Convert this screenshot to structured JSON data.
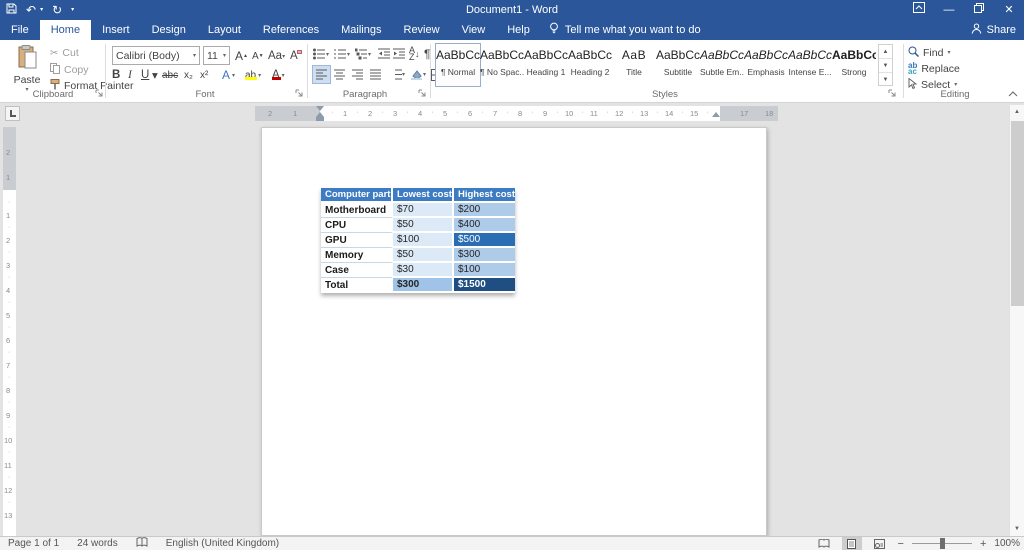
{
  "title_bar": {
    "title": "Document1 - Word"
  },
  "tabs": {
    "items": [
      {
        "label": "File",
        "active": false
      },
      {
        "label": "Home",
        "active": true
      },
      {
        "label": "Insert",
        "active": false
      },
      {
        "label": "Design",
        "active": false
      },
      {
        "label": "Layout",
        "active": false
      },
      {
        "label": "References",
        "active": false
      },
      {
        "label": "Mailings",
        "active": false
      },
      {
        "label": "Review",
        "active": false
      },
      {
        "label": "View",
        "active": false
      },
      {
        "label": "Help",
        "active": false
      }
    ],
    "tell_me": "Tell me what you want to do",
    "share": "Share"
  },
  "ribbon": {
    "clipboard": {
      "label": "Clipboard",
      "paste": "Paste",
      "cut": "Cut",
      "copy": "Copy",
      "format_painter": "Format Painter"
    },
    "font": {
      "label": "Font",
      "name": "Calibri (Body)",
      "size": "11",
      "bold": "B",
      "italic": "I",
      "underline": "U",
      "strike": "abc",
      "sub": "x₂",
      "sup": "x²",
      "grow": "A",
      "shrink": "A",
      "change_case": "Aa"
    },
    "paragraph": {
      "label": "Paragraph",
      "pilcrow": "¶"
    },
    "styles": {
      "label": "Styles",
      "items": [
        {
          "preview": "AaBbCcDc",
          "name": "¶ Normal",
          "cls": "",
          "selected": true
        },
        {
          "preview": "AaBbCcDc",
          "name": "¶ No Spac...",
          "cls": "",
          "selected": false
        },
        {
          "preview": "AaBbCc",
          "name": "Heading 1",
          "cls": "pv-h1",
          "selected": false
        },
        {
          "preview": "AaBbCcC",
          "name": "Heading 2",
          "cls": "pv-h2",
          "selected": false
        },
        {
          "preview": "AaB",
          "name": "Title",
          "cls": "pv-title",
          "selected": false
        },
        {
          "preview": "AaBbCcD",
          "name": "Subtitle",
          "cls": "pv-subtitle",
          "selected": false
        },
        {
          "preview": "AaBbCcDc",
          "name": "Subtle Em...",
          "cls": "pv-subtle",
          "selected": false
        },
        {
          "preview": "AaBbCcDc",
          "name": "Emphasis",
          "cls": "pv-emph",
          "selected": false
        },
        {
          "preview": "AaBbCcDc",
          "name": "Intense E...",
          "cls": "pv-intense",
          "selected": false
        },
        {
          "preview": "AaBbCcDc",
          "name": "Strong",
          "cls": "pv-strong",
          "selected": false
        }
      ]
    },
    "editing": {
      "label": "Editing",
      "find": "Find",
      "replace": "Replace",
      "select": "Select"
    }
  },
  "document": {
    "table": {
      "headers": [
        "Computer part",
        "Lowest cost",
        "Highest cost"
      ],
      "rows": [
        {
          "cells": [
            {
              "t": "Motherboard",
              "c": "part"
            },
            {
              "t": "$70",
              "c": "low"
            },
            {
              "t": "$200",
              "c": "high"
            }
          ]
        },
        {
          "cells": [
            {
              "t": "CPU",
              "c": "part"
            },
            {
              "t": "$50",
              "c": "low"
            },
            {
              "t": "$400",
              "c": "high"
            }
          ]
        },
        {
          "cells": [
            {
              "t": "GPU",
              "c": "part"
            },
            {
              "t": "$100",
              "c": "low"
            },
            {
              "t": "$500",
              "c": "high dark"
            }
          ]
        },
        {
          "cells": [
            {
              "t": "Memory",
              "c": "part"
            },
            {
              "t": "$50",
              "c": "low"
            },
            {
              "t": "$300",
              "c": "high"
            }
          ]
        },
        {
          "cells": [
            {
              "t": "Case",
              "c": "part"
            },
            {
              "t": "$30",
              "c": "low"
            },
            {
              "t": "$100",
              "c": "high"
            }
          ]
        },
        {
          "cells": [
            {
              "t": "Total",
              "c": "part totalpart"
            },
            {
              "t": "$300",
              "c": "low totallow"
            },
            {
              "t": "$1500",
              "c": "high totalhigh"
            }
          ]
        }
      ],
      "colors": {
        "header": "#3d7cc2",
        "low": "#dce9f6",
        "high": "#aecbe9",
        "dark": "#2a6db3",
        "total_dark": "#1f4f82",
        "total_low": "#9fc4e7"
      }
    }
  },
  "ruler": {
    "h": {
      "pre": [
        "2",
        "1"
      ],
      "main": [
        "1",
        "2",
        "3",
        "4",
        "5",
        "6",
        "7",
        "8",
        "9",
        "10",
        "11",
        "12",
        "13",
        "14",
        "15"
      ],
      "post": [
        "17",
        "18"
      ]
    },
    "v": {
      "pre": [
        "2",
        "1"
      ],
      "main": [
        "1",
        "2",
        "3",
        "4",
        "5",
        "6",
        "7",
        "8",
        "9",
        "10",
        "11",
        "12",
        "13"
      ]
    }
  },
  "status_bar": {
    "page": "Page 1 of 1",
    "words": "24 words",
    "language": "English (United Kingdom)",
    "zoom_minus": "−",
    "zoom_plus": "+",
    "zoom_level": "100%"
  }
}
